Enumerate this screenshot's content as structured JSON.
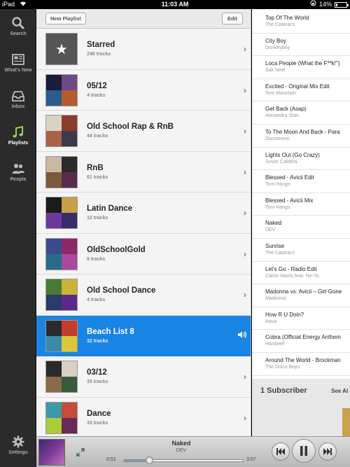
{
  "status_bar": {
    "device": "iPad",
    "time": "11:03 AM",
    "battery": "14%",
    "battery_level": 0.14
  },
  "nav": [
    {
      "label": "Search",
      "icon": "search-icon"
    },
    {
      "label": "What's New",
      "icon": "whats-new-icon"
    },
    {
      "label": "Inbox",
      "icon": "inbox-icon"
    },
    {
      "label": "Playlists",
      "icon": "playlists-icon",
      "active": true
    },
    {
      "label": "People",
      "icon": "people-icon"
    },
    {
      "label": "Settings",
      "icon": "gear-icon"
    }
  ],
  "toolbar": {
    "new_playlist": "New Playlist",
    "edit": "Edit"
  },
  "playlists": [
    {
      "title": "Starred",
      "subtitle": "246 tracks"
    },
    {
      "title": "05/12",
      "subtitle": "4 tracks"
    },
    {
      "title": "Old School Rap & RnB",
      "subtitle": "44 tracks"
    },
    {
      "title": "RnB",
      "subtitle": "61 tracks"
    },
    {
      "title": "Latin Dance",
      "subtitle": "12 tracks"
    },
    {
      "title": "OldSchoolGold",
      "subtitle": "6 tracks"
    },
    {
      "title": "Old School Dance",
      "subtitle": "4 tracks"
    },
    {
      "title": "Beach List 8",
      "subtitle": "32 tracks",
      "selected": true
    },
    {
      "title": "03/12",
      "subtitle": "35 tracks"
    },
    {
      "title": "Dance",
      "subtitle": "33 tracks"
    }
  ],
  "tracks": [
    {
      "title": "Top Of The World",
      "artist": "The Cataracs"
    },
    {
      "title": "City Boy",
      "artist": "Donkeyboy"
    },
    {
      "title": "Loca People (What the F**k!\")",
      "artist": "Sak Noel"
    },
    {
      "title": "Excited - Original Mix Edit",
      "artist": "Tom Mountain"
    },
    {
      "title": "Get Back (Asap)",
      "artist": "Alexandra Stan"
    },
    {
      "title": "To The Moon And Back - Para",
      "artist": "Discotronic"
    },
    {
      "title": "Lights Out (Go Crazy)",
      "artist": "Junior Caldera"
    },
    {
      "title": "Blessed - Avicii Edit",
      "artist": "Tom Hangs"
    },
    {
      "title": "Blessed - Avicii Mix",
      "artist": "Tom Hangs"
    },
    {
      "title": "Naked",
      "artist": "DEV"
    },
    {
      "title": "Sunrise",
      "artist": "The Cataracs"
    },
    {
      "title": "Let's Go - Radio Edit",
      "artist": "Calvin Harris feat. Ne-Yo"
    },
    {
      "title": "Madonna vs. Avicii – Girl Gone",
      "artist": "Madonna"
    },
    {
      "title": "How R U Doin?",
      "artist": "Aqua"
    },
    {
      "title": "Cobra (Official Energy Anthem",
      "artist": "Hardwell"
    },
    {
      "title": "Around The World - Brockman",
      "artist": "The Disco Boys"
    }
  ],
  "subscribers": {
    "count_label": "1 Subscriber",
    "see_all": "See Al"
  },
  "now_playing": {
    "title": "Naked",
    "artist": "DEV",
    "elapsed": "0:51",
    "duration": "3:57",
    "progress": 0.215
  },
  "colors": {
    "selection": "#1a84e4",
    "nav_bg": "#2b2b2b",
    "active_nav": "#9ad14b"
  }
}
